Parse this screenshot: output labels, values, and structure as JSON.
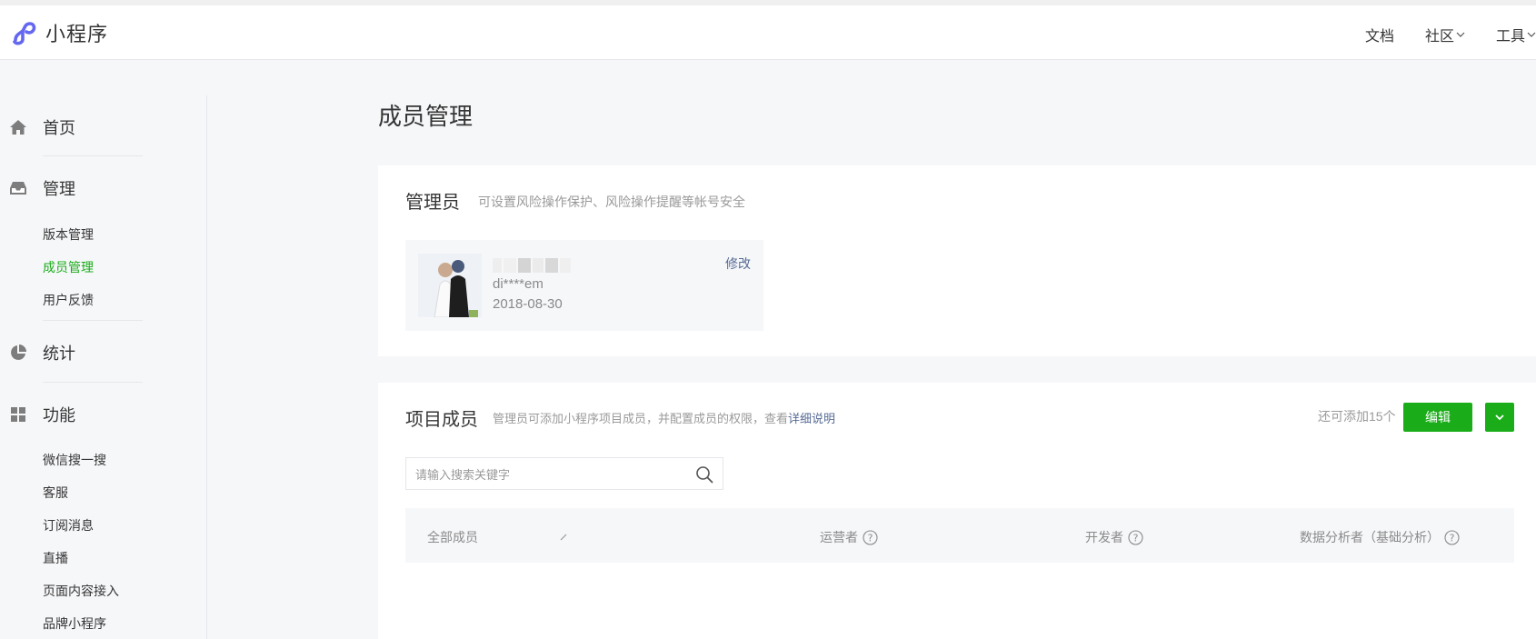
{
  "topbar": {
    "brand": "小程序",
    "nav": [
      {
        "label": "文档",
        "dropdown": false
      },
      {
        "label": "社区",
        "dropdown": true
      },
      {
        "label": "工具",
        "dropdown": true
      }
    ]
  },
  "sidebar": {
    "home": "首页",
    "manage": "管理",
    "manage_items": [
      "版本管理",
      "成员管理",
      "用户反馈"
    ],
    "stats": "统计",
    "features": "功能",
    "feature_items": [
      "微信搜一搜",
      "客服",
      "订阅消息",
      "直播",
      "页面内容接入",
      "品牌小程序"
    ]
  },
  "page": {
    "title": "成员管理"
  },
  "admin_card": {
    "title": "管理员",
    "desc": "可设置风险操作保护、风险操作提醒等帐号安全",
    "admin_id": "di****em",
    "admin_date": "2018-08-30",
    "modify": "修改"
  },
  "members_card": {
    "title": "项目成员",
    "desc": "管理员可添加小程序项目成员，并配置成员的权限，查看",
    "desc_link": "详细说明",
    "remaining": "还可添加15个",
    "edit_button": "编辑",
    "search_placeholder": "请输入搜索关键字",
    "columns": {
      "all": "全部成员",
      "operator": "运营者",
      "developer": "开发者",
      "analyst": "数据分析者（基础分析）"
    }
  },
  "colors": {
    "accent_green": "#1aad19",
    "link_blue": "#576b95",
    "brand_purple": "#6467f0"
  }
}
